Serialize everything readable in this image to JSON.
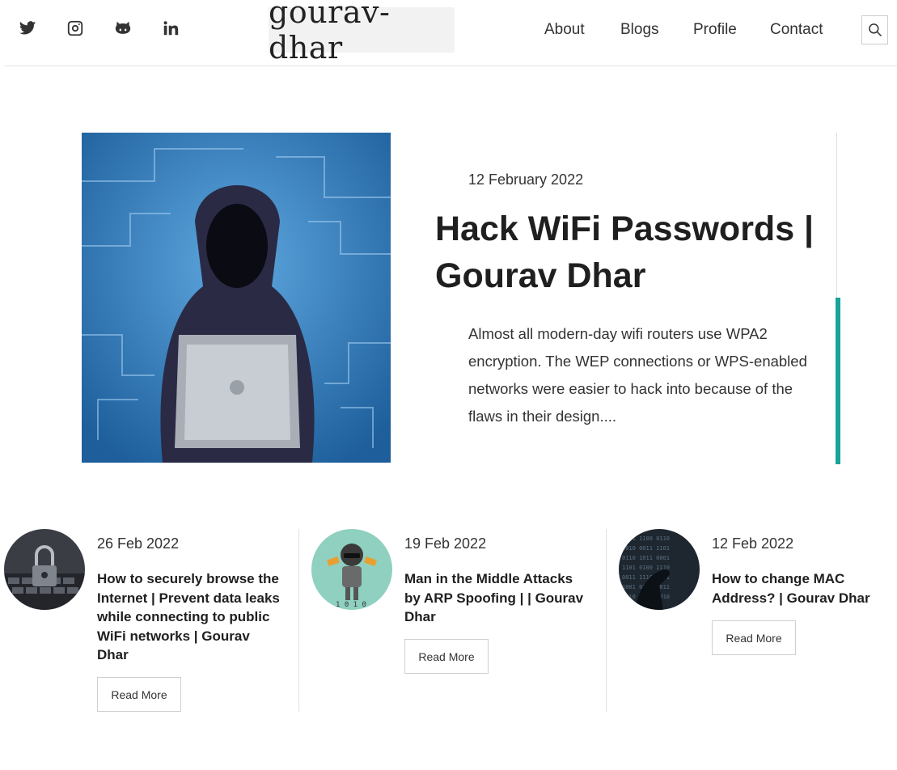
{
  "header": {
    "social": [
      {
        "icon": "twitter-icon"
      },
      {
        "icon": "instagram-icon"
      },
      {
        "icon": "github-icon"
      },
      {
        "icon": "linkedin-icon"
      }
    ],
    "logo": "gourav-dhar",
    "nav": [
      "About",
      "Blogs",
      "Profile",
      "Contact"
    ],
    "search_icon": "search-icon"
  },
  "featured": {
    "date": "12 February 2022",
    "title": "Hack WiFi Passwords | Gourav Dhar",
    "excerpt": "Almost all modern-day wifi routers use WPA2 encryption. The WEP connections or WPS-enabled networks were easier to hack into because of the flaws in their design....",
    "accent_color": "#17a49a"
  },
  "cards": [
    {
      "date": "26 Feb 2022",
      "title": "How to securely browse the Internet | Prevent data leaks while connecting to public WiFi networks | Gourav Dhar",
      "button": "Read More"
    },
    {
      "date": "19 Feb 2022",
      "title": "Man in the Middle Attacks by ARP Spoofing | | Gourav Dhar",
      "button": "Read More"
    },
    {
      "date": "12 Feb 2022",
      "title": "How to change MAC Address? | Gourav Dhar",
      "button": "Read More"
    }
  ]
}
